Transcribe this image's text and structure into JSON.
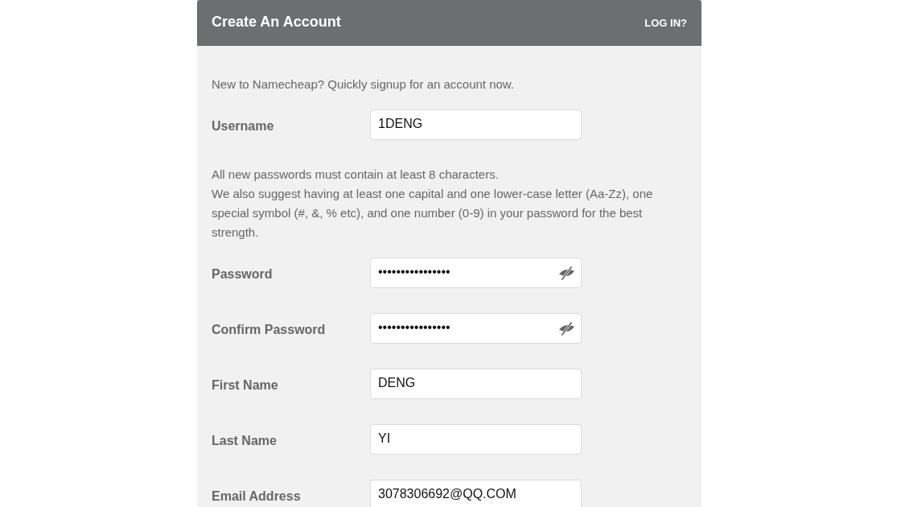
{
  "header": {
    "title": "Create An Account",
    "login_link": "LOG IN?"
  },
  "form": [
    {
      "kind": "text",
      "text": "New to Namecheap? Quickly signup for an account now."
    },
    {
      "kind": "field",
      "label": "Username",
      "value": "1DENG"
    },
    {
      "kind": "text",
      "text": "All new passwords must contain at least 8 characters.\nWe also suggest having at least one capital and one lower-case letter (Aa-Zz), one special symbol (#, &, % etc), and one number (0-9) in your password for the best strength."
    },
    {
      "kind": "password",
      "label": "Password",
      "value": "••••••••••••••••",
      "revealed": false
    },
    {
      "kind": "password",
      "label": "Confirm Password",
      "value": "••••••••••••••••",
      "revealed": false
    },
    {
      "kind": "field",
      "label": "First Name",
      "value": "DENG"
    },
    {
      "kind": "field",
      "label": "Last Name",
      "value": "YI"
    },
    {
      "kind": "field",
      "label": "Email Address",
      "value": "3078306692@QQ.COM"
    }
  ]
}
